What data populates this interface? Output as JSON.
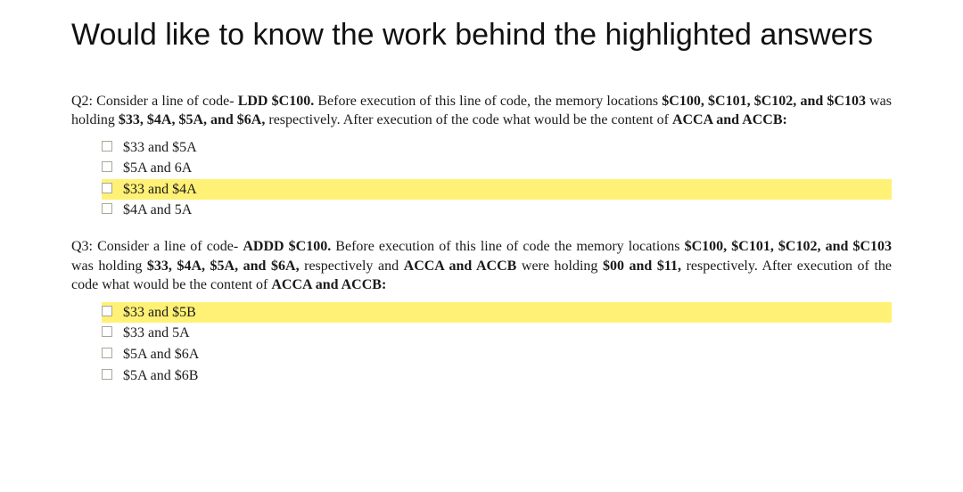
{
  "title": "Would like to know the work behind the highlighted answers",
  "q2": {
    "label": "Q2:",
    "text_parts": [
      "Consider a line of code- ",
      "LDD    $C100.",
      "  Before execution of this line of code, the memory locations ",
      "$C100, $C101, $C102, and $C103",
      " was holding ",
      "$33, $4A, $5A, and $6A,",
      " respectively.  After execution of the code what would be the content of ",
      "ACCA and ACCB:"
    ],
    "options": [
      {
        "text": "$33 and $5A",
        "highlight": false
      },
      {
        "text": "$5A and 6A",
        "highlight": false
      },
      {
        "text": "$33 and $4A",
        "highlight": true
      },
      {
        "text": "$4A and 5A",
        "highlight": false
      }
    ]
  },
  "q3": {
    "label": "Q3:",
    "text_parts": [
      "Consider a line of code- ",
      "ADDD    $C100.",
      "  Before execution of this line of code the memory locations ",
      "$C100, $C101, $C102, and $C103",
      " was holding ",
      "$33, $4A, $5A, and $6A,",
      " respectively and ",
      "ACCA and ACCB",
      " were holding ",
      "$00 and $11,",
      " respectively.   After execution of the code what would be the content of ",
      "ACCA and ACCB:"
    ],
    "options": [
      {
        "text": "$33 and $5B",
        "highlight": true
      },
      {
        "text": "$33 and 5A",
        "highlight": false
      },
      {
        "text": "$5A and $6A",
        "highlight": false
      },
      {
        "text": "$5A and $6B",
        "highlight": false
      }
    ]
  }
}
